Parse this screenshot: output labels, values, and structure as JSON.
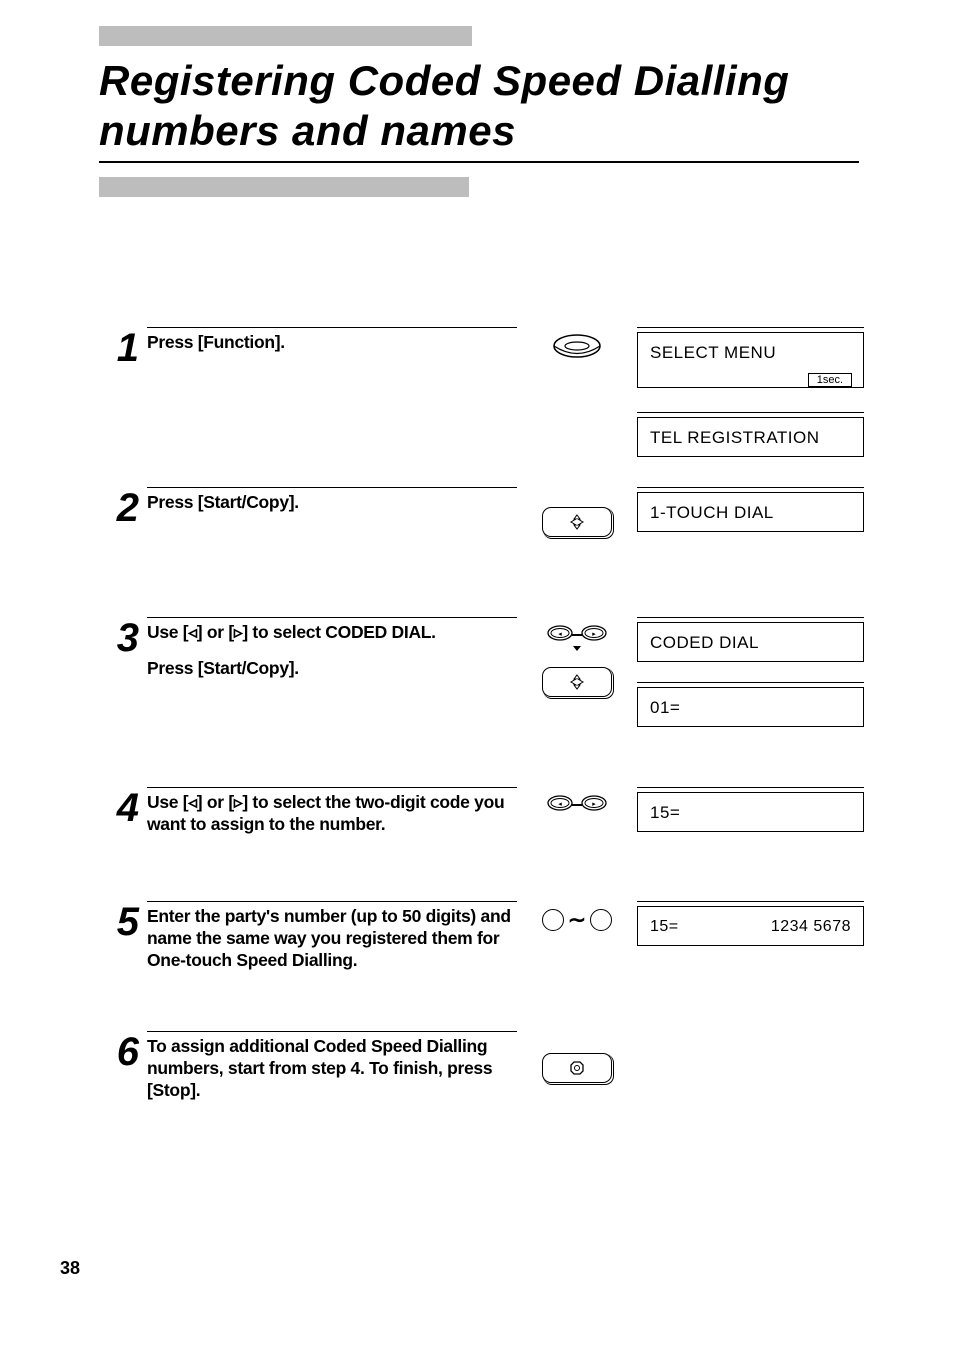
{
  "title": "Registering Coded Speed Dialling numbers and names",
  "page_number": "38",
  "timer_label": "1sec.",
  "steps": [
    {
      "num": "1",
      "text": "Press [Function].",
      "icon": "oval",
      "displays": [
        {
          "text": "SELECT MENU",
          "timer": true
        },
        {
          "text": "TEL REGISTRATION"
        }
      ]
    },
    {
      "num": "2",
      "text": "Press [Start/Copy].",
      "icon": "start",
      "displays": [
        {
          "text": "1-TOUCH DIAL"
        }
      ]
    },
    {
      "num": "3",
      "lines": [
        "Use [◃] or [▹] to select CODED DIAL.",
        "Press [Start/Copy]."
      ],
      "icon": "arrows-start",
      "displays": [
        {
          "text": "CODED DIAL"
        },
        {
          "text": "01="
        }
      ]
    },
    {
      "num": "4",
      "text": "Use [◃] or [▹] to select the two-digit code you want to assign to the number.",
      "icon": "arrows",
      "displays": [
        {
          "text": "15="
        }
      ]
    },
    {
      "num": "5",
      "text": "Enter the party's number (up to 50 digits) and name the same way you registered them for One-touch Speed Dialling.",
      "icon": "keypad",
      "displays": [
        {
          "left": "15=",
          "right": "1234 5678"
        }
      ]
    },
    {
      "num": "6",
      "text": "To assign additional Coded Speed Dialling numbers, start from step 4. To finish, press [Stop].",
      "icon": "stop",
      "displays": []
    }
  ]
}
